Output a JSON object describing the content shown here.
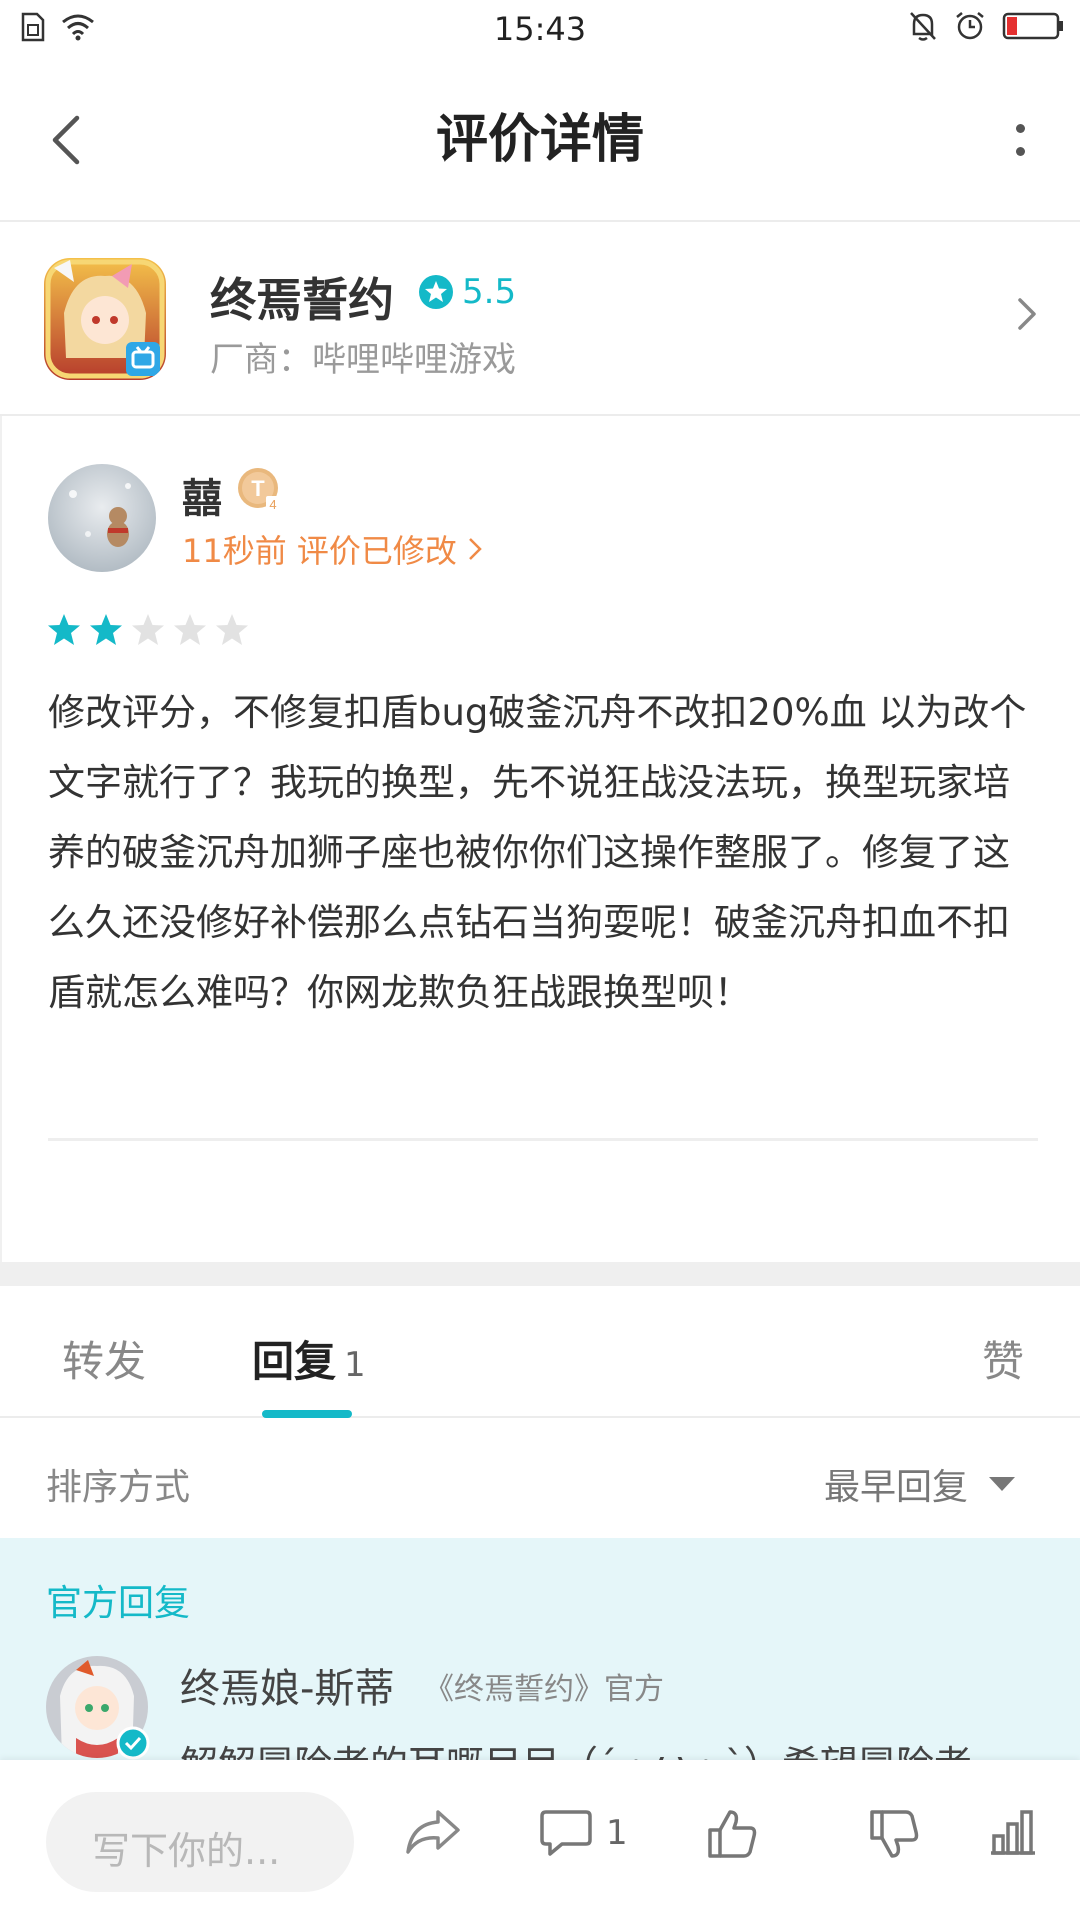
{
  "status_bar": {
    "time": "15:43"
  },
  "title_bar": {
    "title": "评价详情"
  },
  "game": {
    "name": "终焉誓约",
    "rating": "5.5",
    "vendor": "厂商：哔哩哔哩游戏"
  },
  "review": {
    "user_name": "囍",
    "level_badge": "T",
    "meta": "11秒前 评价已修改",
    "stars_filled": 2,
    "stars_total": 5,
    "text": "修改评分，不修复扣盾bug破釜沉舟不改扣20%血 以为改个文字就行了？我玩的换型，先不说狂战没法玩，换型玩家培养的破釜沉舟加狮子座也被你你们这操作整服了。修复了这么久还没修好补偿那么点钻石当狗耍呢！破釜沉舟扣血不扣盾就怎么难吗？你网龙欺负狂战跟换型呗！"
  },
  "tabs": {
    "forward": "转发",
    "reply": "回复",
    "reply_count": "1",
    "like": "赞"
  },
  "sort": {
    "label": "排序方式",
    "value": "最早回复"
  },
  "official": {
    "label": "官方回复",
    "name": "终焉娘-斯蒂",
    "tag": "《终焉誓约》官方",
    "text": "解解冒险者的耳嘅目目（´・ω・`）希望冒险者"
  },
  "bottom_bar": {
    "input_placeholder": "写下你的...",
    "comment_count": "1"
  },
  "colors": {
    "accent": "#14b9c8",
    "meta_orange": "#f08a46",
    "official_bg": "#e5f6f9"
  }
}
